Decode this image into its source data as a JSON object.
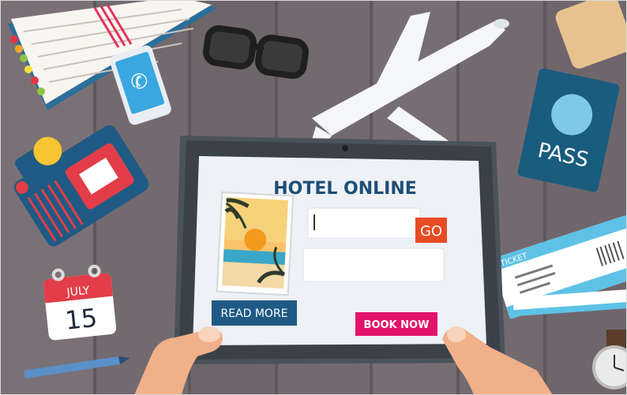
{
  "screen": {
    "title": "HOTEL ONLINE",
    "search_value": "",
    "go_label": "GO",
    "second_field_value": "",
    "read_more_label": "READ MORE",
    "book_now_label": "BOOK NOW"
  },
  "props": {
    "passport_label": "PASS",
    "calendar_month": "JULY",
    "calendar_day": "15",
    "ticket_label": "TICKET"
  },
  "colors": {
    "desk": "#736a70",
    "plank_line": "#5f575c",
    "tablet_frame": "#3a4248",
    "screen_bg": "#eef1f5",
    "title_navy": "#1d4e78",
    "go_orange": "#e84c24",
    "read_more_navy": "#1f5a84",
    "book_now_pink": "#e3136b",
    "passport_navy": "#1a5c7e",
    "passport_circle": "#7ec8e8",
    "calendar_red": "#e23d48",
    "ticket_blue": "#5ec2e6",
    "skin": "#f0b08a"
  },
  "icons": [
    "notebook-icon",
    "phone-icon",
    "sunglasses-icon",
    "airplane-icon",
    "camera-icon",
    "passport-icon",
    "calendar-icon",
    "ticket-icon",
    "pen-icon",
    "watch-icon",
    "beach-photo-icon"
  ]
}
